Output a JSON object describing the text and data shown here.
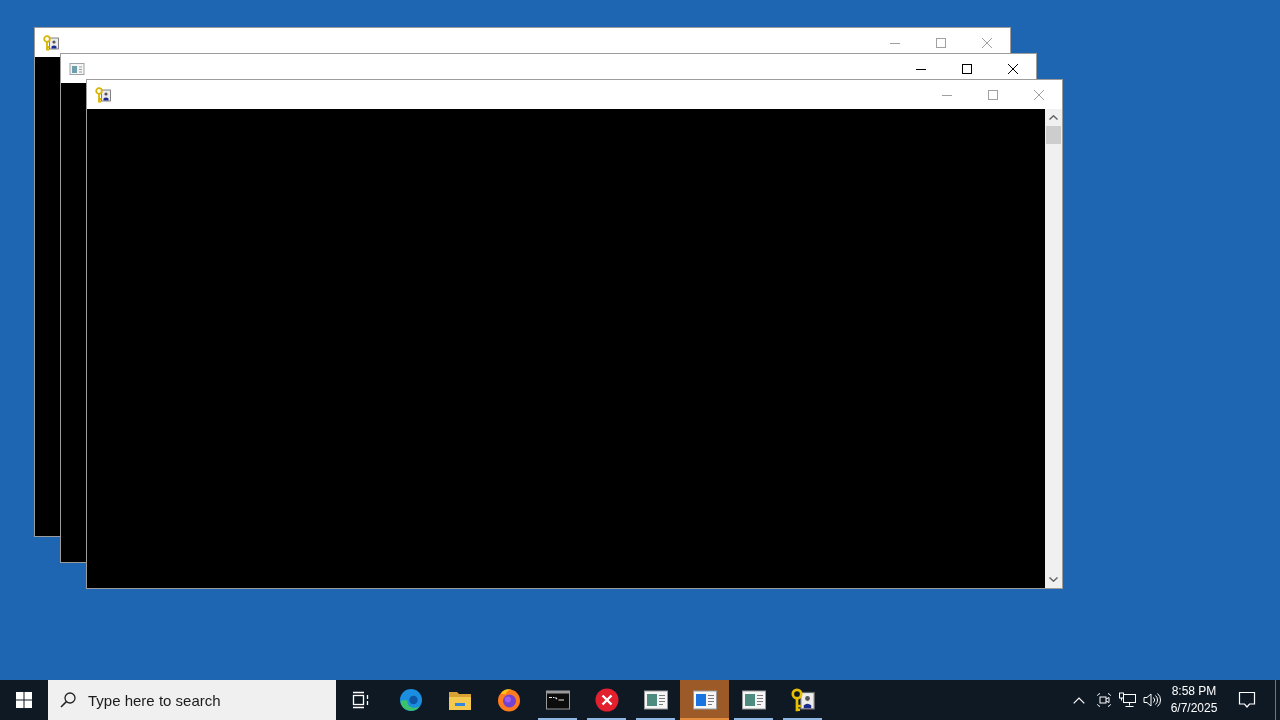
{
  "windows": [
    {
      "kind": "keys",
      "active": false
    },
    {
      "kind": "window",
      "active": true
    },
    {
      "kind": "keys",
      "active": false,
      "scrollbar": true
    }
  ],
  "taskbar": {
    "search": {
      "placeholder": "Type here to search"
    },
    "apps": [
      {
        "kind": "swirl",
        "running": false,
        "selected": false
      },
      {
        "kind": "folder",
        "running": false,
        "selected": false
      },
      {
        "kind": "fox",
        "running": false,
        "selected": false
      },
      {
        "kind": "terminal",
        "running": true,
        "selected": false
      },
      {
        "kind": "error",
        "running": true,
        "selected": false
      },
      {
        "kind": "window",
        "running": true,
        "selected": false
      },
      {
        "kind": "window",
        "running": true,
        "selected": true
      },
      {
        "kind": "window",
        "running": true,
        "selected": false
      },
      {
        "kind": "keys",
        "running": true,
        "selected": false
      }
    ],
    "clock": {
      "time": "8:58 PM",
      "date": "6/7/2025"
    }
  }
}
